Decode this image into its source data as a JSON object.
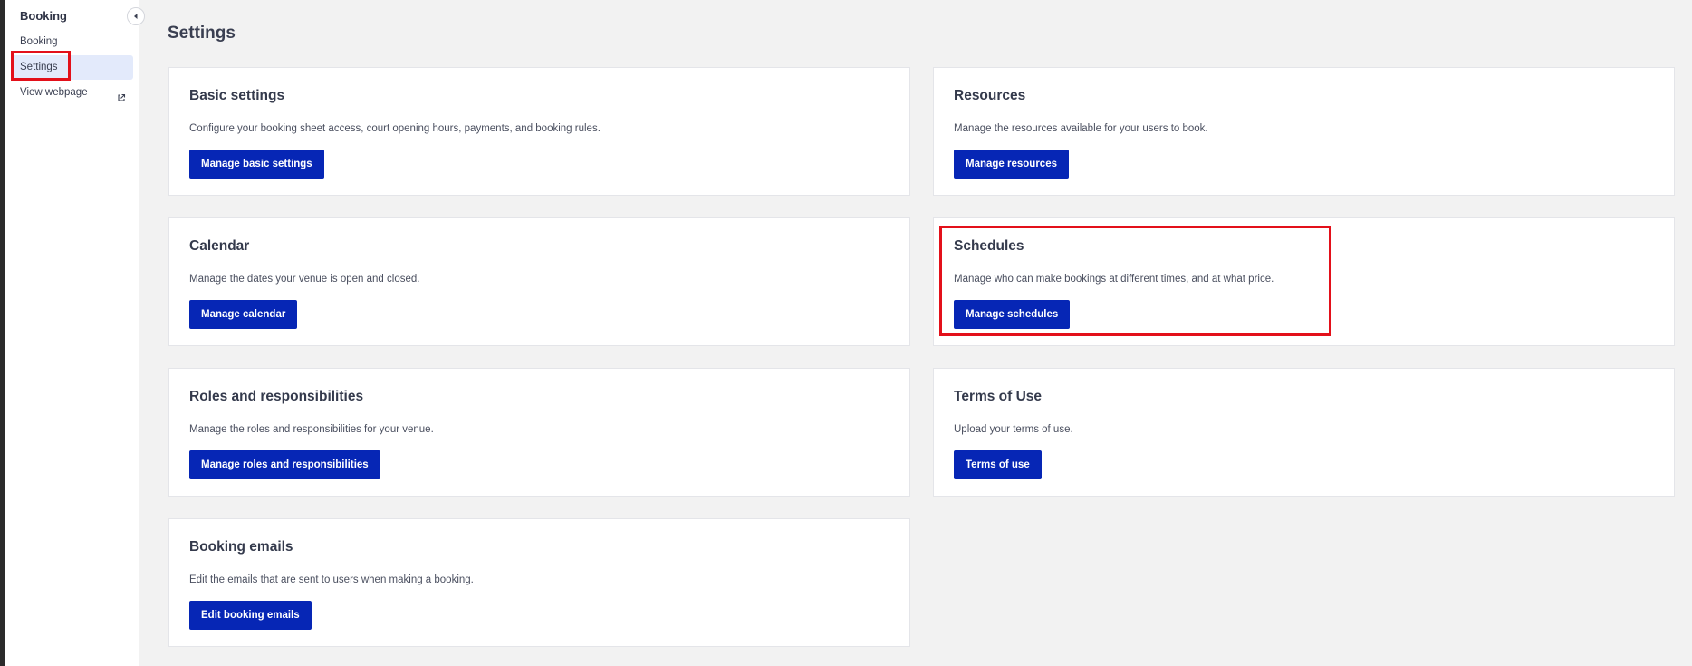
{
  "sidebar": {
    "title": "Booking",
    "items": [
      {
        "label": "Booking"
      },
      {
        "label": "Settings",
        "active": true
      },
      {
        "label": "View webpage",
        "icon": "external-link-icon"
      }
    ],
    "collapse_icon": "chevron-left-icon"
  },
  "main": {
    "page_title": "Settings",
    "cards": [
      {
        "title": "Basic settings",
        "description": "Configure your booking sheet access, court opening hours, payments, and booking rules.",
        "button": "Manage basic settings"
      },
      {
        "title": "Resources",
        "description": "Manage the resources available for your users to book.",
        "button": "Manage resources"
      },
      {
        "title": "Calendar",
        "description": "Manage the dates your venue is open and closed.",
        "button": "Manage calendar"
      },
      {
        "title": "Schedules",
        "description": "Manage who can make bookings at different times, and at what price.",
        "button": "Manage schedules"
      },
      {
        "title": "Roles and responsibilities",
        "description": "Manage the roles and responsibilities for your venue.",
        "button": "Manage roles and responsibilities"
      },
      {
        "title": "Terms of Use",
        "description": "Upload your terms of use.",
        "button": "Terms of use"
      },
      {
        "title": "Booking emails",
        "description": "Edit the emails that are sent to users when making a booking.",
        "button": "Edit booking emails"
      }
    ]
  },
  "colors": {
    "primary_button": "#0626b5",
    "highlight": "#e3101a",
    "active_nav_bg": "#e3eafb",
    "page_bg": "#f2f2f2"
  }
}
